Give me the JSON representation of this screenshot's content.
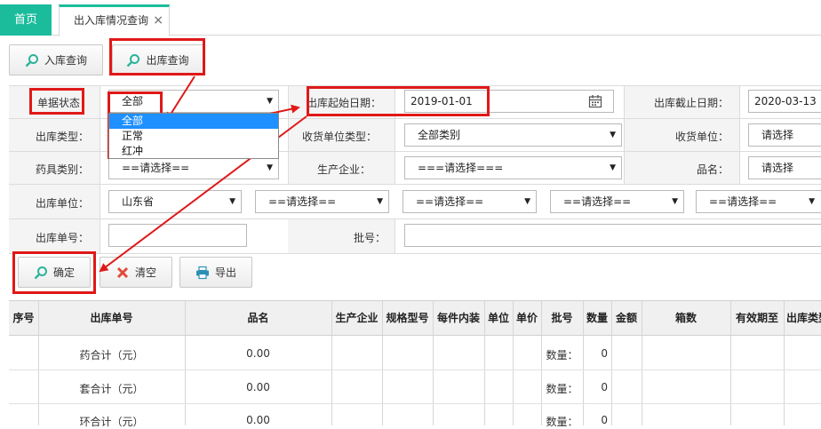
{
  "tabs": {
    "home": "首页",
    "active": "出入库情况查询",
    "close": "×"
  },
  "toolbar": {
    "in_query": "入库查询",
    "out_query": "出库查询"
  },
  "form": {
    "doc_status_label": "单据状态",
    "doc_status_value": "全部",
    "doc_status_options": [
      "全部",
      "正常",
      "红冲"
    ],
    "out_start_label": "出库起始日期：",
    "out_start_value": "2019-01-01",
    "out_end_label": "出库截止日期：",
    "out_end_value": "2020-03-13",
    "out_type_label": "出库类型：",
    "recv_unit_type_label": "收货单位类型：",
    "recv_unit_type_value": "全部类别",
    "recv_unit_label": "收货单位：",
    "recv_unit_value": "请选择",
    "drug_cat_label": "药具类别：",
    "drug_cat_value": "==请选择==",
    "manufacturer_label": "生产企业：",
    "manufacturer_value": "===请选择===",
    "product_label": "品名：",
    "product_value": "请选择",
    "out_unit_label": "出库单位：",
    "province_value": "山东省",
    "sub1_value": "==请选择==",
    "sub2_value": "==请选择==",
    "sub3_value": "==请选择==",
    "sub4_value": "==请选择==",
    "out_no_label": "出库单号：",
    "batch_label": "批号："
  },
  "actions": {
    "confirm": "确定",
    "clear": "清空",
    "export": "导出"
  },
  "table": {
    "headers": [
      "序号",
      "出库单号",
      "品名",
      "生产企业",
      "规格型号",
      "每件内装",
      "单位",
      "单价",
      "批号",
      "数量",
      "金额",
      "箱数",
      "有效期至",
      "出库类型"
    ],
    "rows": [
      {
        "no_col": "药合计（元）",
        "product": "0.00",
        "qty_label": "数量：",
        "qty": "0"
      },
      {
        "no_col": "套合计（元）",
        "product": "0.00",
        "qty_label": "数量：",
        "qty": "0"
      },
      {
        "no_col": "环合计（元）",
        "product": "0.00",
        "qty_label": "数量：",
        "qty": "0"
      }
    ]
  },
  "colors": {
    "accent": "#1bbc9b",
    "highlight": "#e01818",
    "selected": "#1e90ff"
  }
}
